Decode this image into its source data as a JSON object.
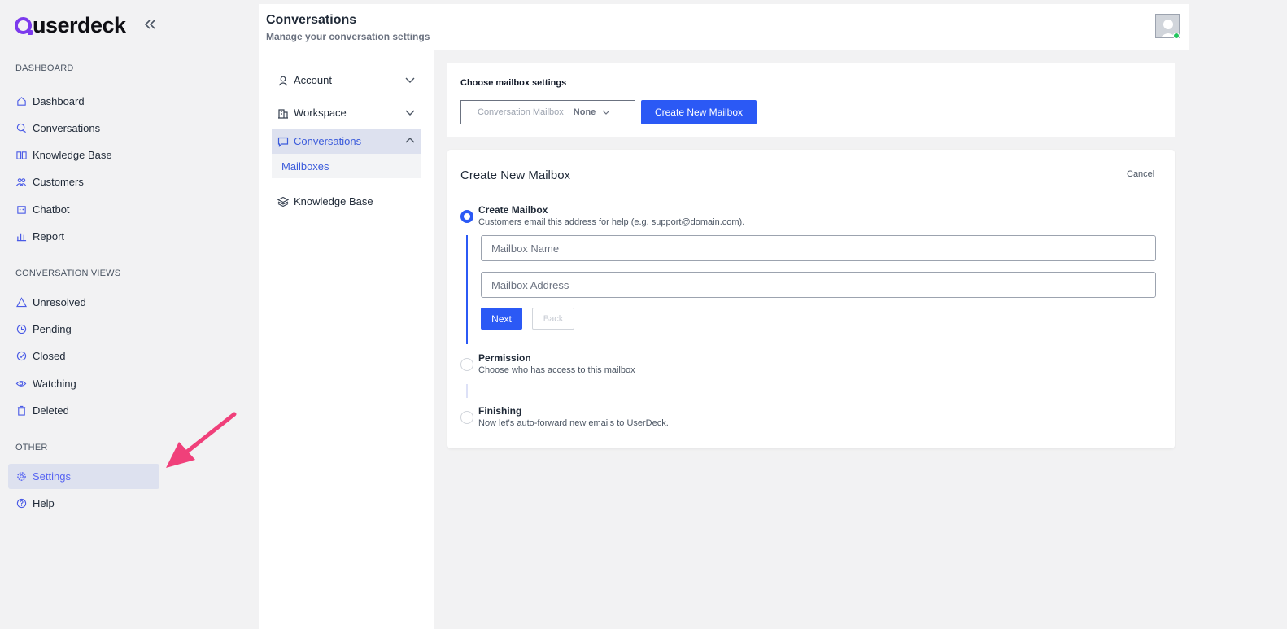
{
  "app": {
    "logo_text": "userdeck"
  },
  "sidebar": {
    "sections": [
      {
        "label": "DASHBOARD"
      },
      {
        "label": "CONVERSATION VIEWS"
      },
      {
        "label": "OTHER"
      }
    ],
    "items": [
      {
        "label": "Dashboard",
        "icon": "home-icon"
      },
      {
        "label": "Conversations",
        "icon": "chat-icon"
      },
      {
        "label": "Knowledge Base",
        "icon": "book-icon"
      },
      {
        "label": "Customers",
        "icon": "users-icon"
      },
      {
        "label": "Chatbot",
        "icon": "bot-icon"
      },
      {
        "label": "Report",
        "icon": "bar-chart-icon"
      },
      {
        "label": "Unresolved",
        "icon": "warning-icon"
      },
      {
        "label": "Pending",
        "icon": "clock-icon"
      },
      {
        "label": "Closed",
        "icon": "check-circle-icon"
      },
      {
        "label": "Watching",
        "icon": "eye-icon"
      },
      {
        "label": "Deleted",
        "icon": "trash-icon"
      },
      {
        "label": "Settings",
        "icon": "gear-icon",
        "active": true
      },
      {
        "label": "Help",
        "icon": "help-icon"
      }
    ]
  },
  "header": {
    "title": "Conversations",
    "subtitle": "Manage your conversation settings"
  },
  "subnav": {
    "items": [
      {
        "label": "Account",
        "icon": "user-icon"
      },
      {
        "label": "Workspace",
        "icon": "building-icon"
      },
      {
        "label": "Conversations",
        "icon": "message-icon",
        "active": true
      },
      {
        "label": "Knowledge Base",
        "icon": "layers-icon"
      }
    ],
    "child": {
      "label": "Mailboxes"
    }
  },
  "mailbox_settings": {
    "title": "Choose mailbox settings",
    "select_label": "Conversation Mailbox",
    "select_value": "None",
    "create_button": "Create New Mailbox"
  },
  "create_form": {
    "title": "Create New Mailbox",
    "cancel": "Cancel",
    "steps": [
      {
        "title": "Create Mailbox",
        "desc": "Customers email this address for help (e.g. support@domain.com).",
        "active": true
      },
      {
        "title": "Permission",
        "desc": "Choose who has access to this mailbox"
      },
      {
        "title": "Finishing",
        "desc": "Now let's auto-forward new emails to UserDeck."
      }
    ],
    "name_placeholder": "Mailbox Name",
    "address_placeholder": "Mailbox Address",
    "next_label": "Next",
    "back_label": "Back"
  },
  "colors": {
    "accent": "#2b59f5",
    "brand": "#7c3aed",
    "active_bg": "#dde1ef",
    "annotation_arrow": "#f0407a"
  }
}
